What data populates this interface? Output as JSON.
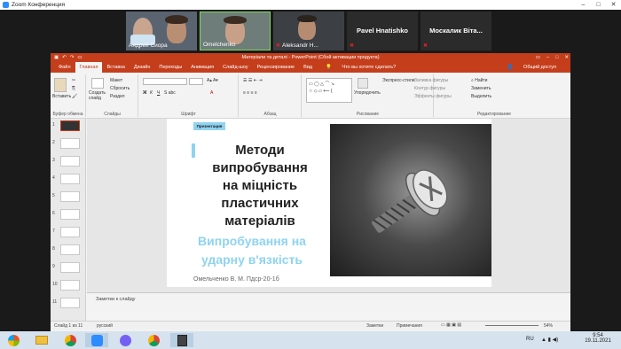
{
  "zoom": {
    "title": "Zoom Конференция"
  },
  "participants": [
    {
      "name": "Андрей Сиора"
    },
    {
      "name": "Omelchenko"
    },
    {
      "name": "Aleksandr H..."
    },
    {
      "name": "Pavel Hnatishko"
    },
    {
      "name": "Москалик  Віта..."
    }
  ],
  "ppt": {
    "title": "Матеріали та деталі - PowerPoint (Сбой активации продукта)",
    "tabs": [
      "Файл",
      "Главная",
      "Вставка",
      "Дизайн",
      "Переходы",
      "Анимация",
      "Слайд-шоу",
      "Рецензирование",
      "Вид",
      "Что вы хотите сделать?"
    ],
    "share": "Общий доступ",
    "groups": {
      "clipboard": "Буфер обмена",
      "slides": "Слайды",
      "font": "Шрифт",
      "paragraph": "Абзац",
      "drawing": "Рисование",
      "editing": "Редактирование"
    },
    "ribbon": {
      "paste": "Вставить",
      "new_slide": "Создать слайд",
      "layout": "Макет",
      "reset": "Сбросить",
      "section": "Раздел",
      "arrange": "Упорядочить",
      "quick_styles": "Экспресс-стили",
      "shape_fill": "Заливка фигуры",
      "shape_outline": "Контур фигуры",
      "shape_effects": "Эффекты фигуры",
      "find": "Найти",
      "replace": "Заменить",
      "select": "Выделить"
    },
    "slide": {
      "tag": "Презентация",
      "title_lines": [
        "Методи",
        "випробування",
        "на міцність",
        "пластичних",
        "матеріалів"
      ],
      "subtitle_lines": [
        "Випробування на",
        "ударну в'язкість"
      ],
      "author": "Омельченко В. М. Пдср-20-1б"
    },
    "notes": "Заметки к слайду",
    "status": {
      "slide": "Слайд 1 из 11",
      "lang": "русский",
      "notes_btn": "Заметки",
      "comments_btn": "Примечания",
      "zoom": "54%"
    },
    "thumb_numbers": [
      "1",
      "2",
      "3",
      "4",
      "5",
      "6",
      "7",
      "8",
      "9",
      "10",
      "11"
    ]
  },
  "taskbar": {
    "lang": "RU",
    "time": "9:54",
    "date": "19.11.2021"
  }
}
